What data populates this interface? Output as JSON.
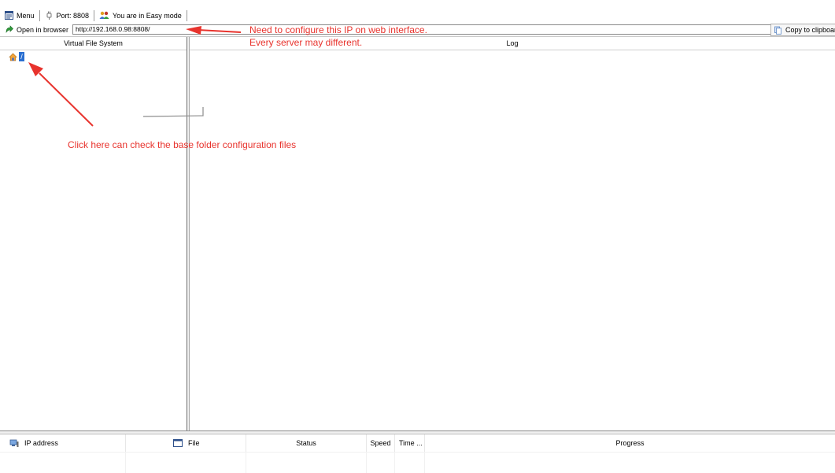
{
  "toolbar": {
    "menu_label": "Menu",
    "port_label": "Port: 8808",
    "mode_label": "You are in Easy mode"
  },
  "urlbar": {
    "open_label": "Open in browser",
    "url_value": "http://192.168.0.98:8808/",
    "copy_label": "Copy to clipboar"
  },
  "panes": {
    "vfs_title": "Virtual File System",
    "log_title": "Log",
    "root_label": "/"
  },
  "connections": {
    "columns": [
      "IP address",
      "File",
      "Status",
      "Speed",
      "Time ...",
      "Progress"
    ]
  },
  "annotations": {
    "ip_note_line1": "Need to configure this IP on web interface.",
    "ip_note_line2": "Every server may different.",
    "folder_note": "Click here can check the base folder configuration files",
    "color": "#e8332d"
  },
  "colors": {
    "selection_blue": "#2a6fd1",
    "border_gray": "#8a8a8a"
  }
}
